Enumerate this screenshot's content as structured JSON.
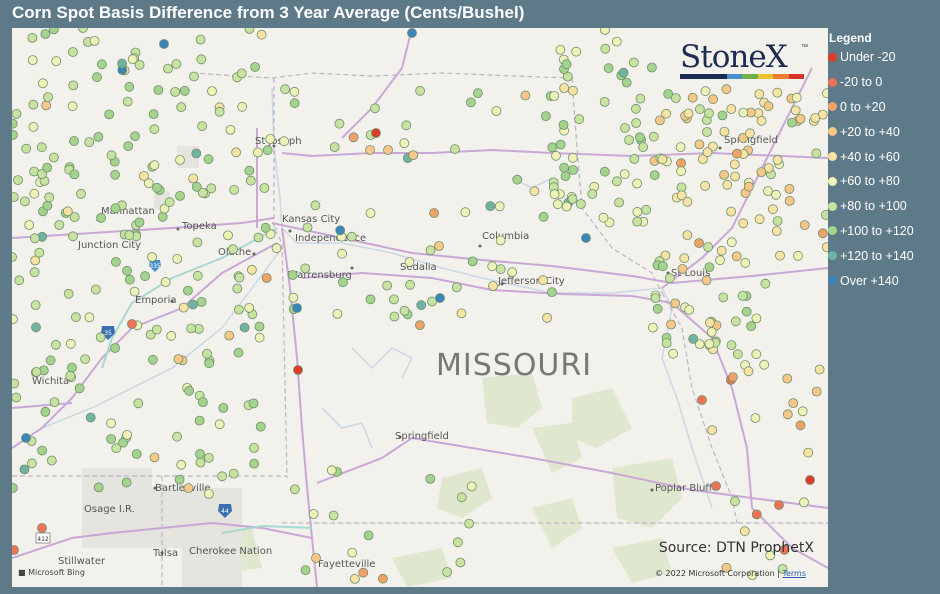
{
  "title": "Corn Spot Basis Difference from 3 Year Average (Cents/Bushel)",
  "legend": {
    "title": "Legend",
    "items": [
      {
        "label": "Under -20",
        "color": "#e03a2b"
      },
      {
        "label": "-20 to 0",
        "color": "#ef7158"
      },
      {
        "label": "0 to +20",
        "color": "#f1a168"
      },
      {
        "label": "+20 to +40",
        "color": "#f7c789"
      },
      {
        "label": "+40 to +60",
        "color": "#f8e3a4"
      },
      {
        "label": "+60 to +80",
        "color": "#eef2b8"
      },
      {
        "label": "+80 to +100",
        "color": "#c8e3a1"
      },
      {
        "label": "+100 to +120",
        "color": "#a4d38d"
      },
      {
        "label": "+120 to +140",
        "color": "#70b2a4"
      },
      {
        "label": "Over +140",
        "color": "#3a86bb"
      }
    ]
  },
  "map": {
    "state_label": "MISSOURI",
    "cities": [
      "St Joseph",
      "Manhattan",
      "Topeka",
      "Junction City",
      "Kansas City",
      "Independence",
      "Olathe",
      "Columbia",
      "Sedalia",
      "Warrensburg",
      "Jefferson City",
      "Emporia",
      "Springfield",
      "St Louis",
      "Wichita",
      "Bartlesville",
      "Osage I.R.",
      "Poplar Bluff",
      "Tulsa",
      "Cherokee Nation",
      "Stillwater",
      "Fayetteville"
    ],
    "highways": [
      "335",
      "35",
      "44",
      "412"
    ]
  },
  "logo": {
    "text": "StoneX",
    "tm": "™"
  },
  "source": "Source: DTN ProphetX",
  "copyright": "© 2022 Microsoft Corporation",
  "terms": "Terms",
  "bing": "Microsoft Bing"
}
